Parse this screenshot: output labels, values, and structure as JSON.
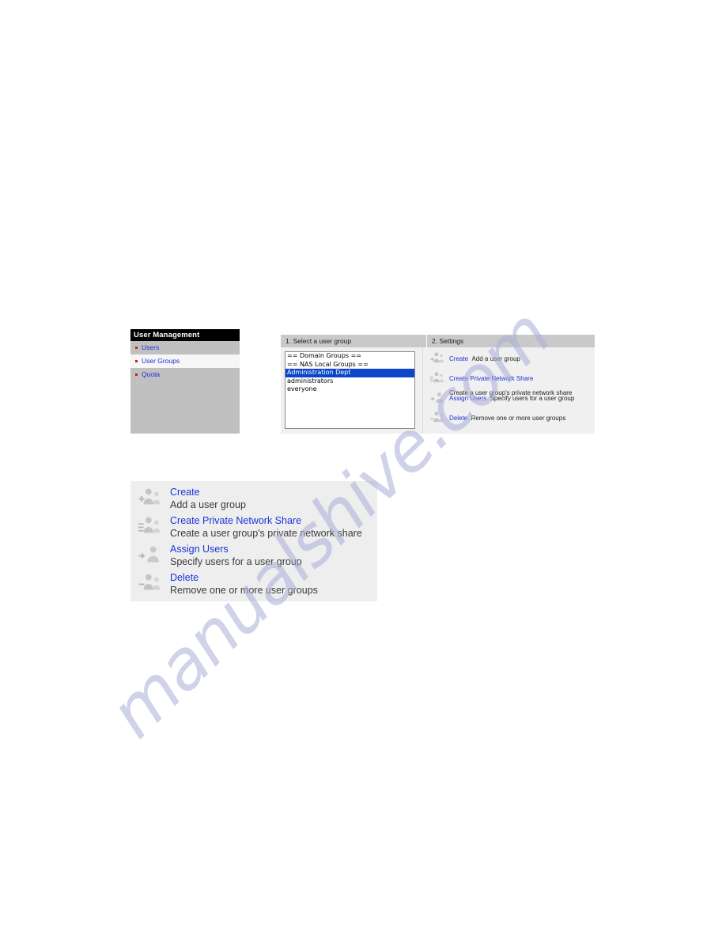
{
  "watermark": {
    "text": "manualshive.com"
  },
  "colors": {
    "link": "#1b2fd8",
    "selection": "#0b46c8",
    "bullet": "#cc2222",
    "titlebar": "#000000",
    "sidebar_bg": "#c0c0c0",
    "panel_bg": "#f0f0f0",
    "header_bg": "#c9c9c9"
  },
  "figure_top": {
    "sidebar": {
      "title": "User Management",
      "items": [
        {
          "label": "Users",
          "selected": false
        },
        {
          "label": "User Groups",
          "selected": true
        },
        {
          "label": "Quota",
          "selected": false
        }
      ]
    },
    "columns": {
      "left_header": "1. Select a user group",
      "right_header": "2. Settings"
    },
    "user_group_list": [
      {
        "label": "== Domain Groups ==",
        "selected": false
      },
      {
        "label": "== NAS Local Groups ==",
        "selected": false
      },
      {
        "label": "Administration Dept",
        "selected": true
      },
      {
        "label": "administrators",
        "selected": false
      },
      {
        "label": "everyone",
        "selected": false
      }
    ],
    "settings_actions": [
      {
        "icon": "add-user-group-icon",
        "title": "Create",
        "description": "Add a user group"
      },
      {
        "icon": "network-share-group-icon",
        "title": "Create Private Network Share",
        "description": "Create a user group's private network share"
      },
      {
        "icon": "assign-users-icon",
        "title": "Assign Users",
        "description": "Specify users for a user group"
      },
      {
        "icon": "remove-user-group-icon",
        "title": "Delete",
        "description": "Remove one or more user groups"
      }
    ]
  },
  "figure_bottom": {
    "actions": [
      {
        "icon": "add-user-group-icon",
        "title": "Create",
        "description": "Add a user group"
      },
      {
        "icon": "network-share-group-icon",
        "title": "Create Private Network Share",
        "description": "Create a user group's private network share"
      },
      {
        "icon": "assign-users-icon",
        "title": "Assign Users",
        "description": "Specify users for a user group"
      },
      {
        "icon": "remove-user-group-icon",
        "title": "Delete",
        "description": "Remove one or more user groups"
      }
    ]
  }
}
